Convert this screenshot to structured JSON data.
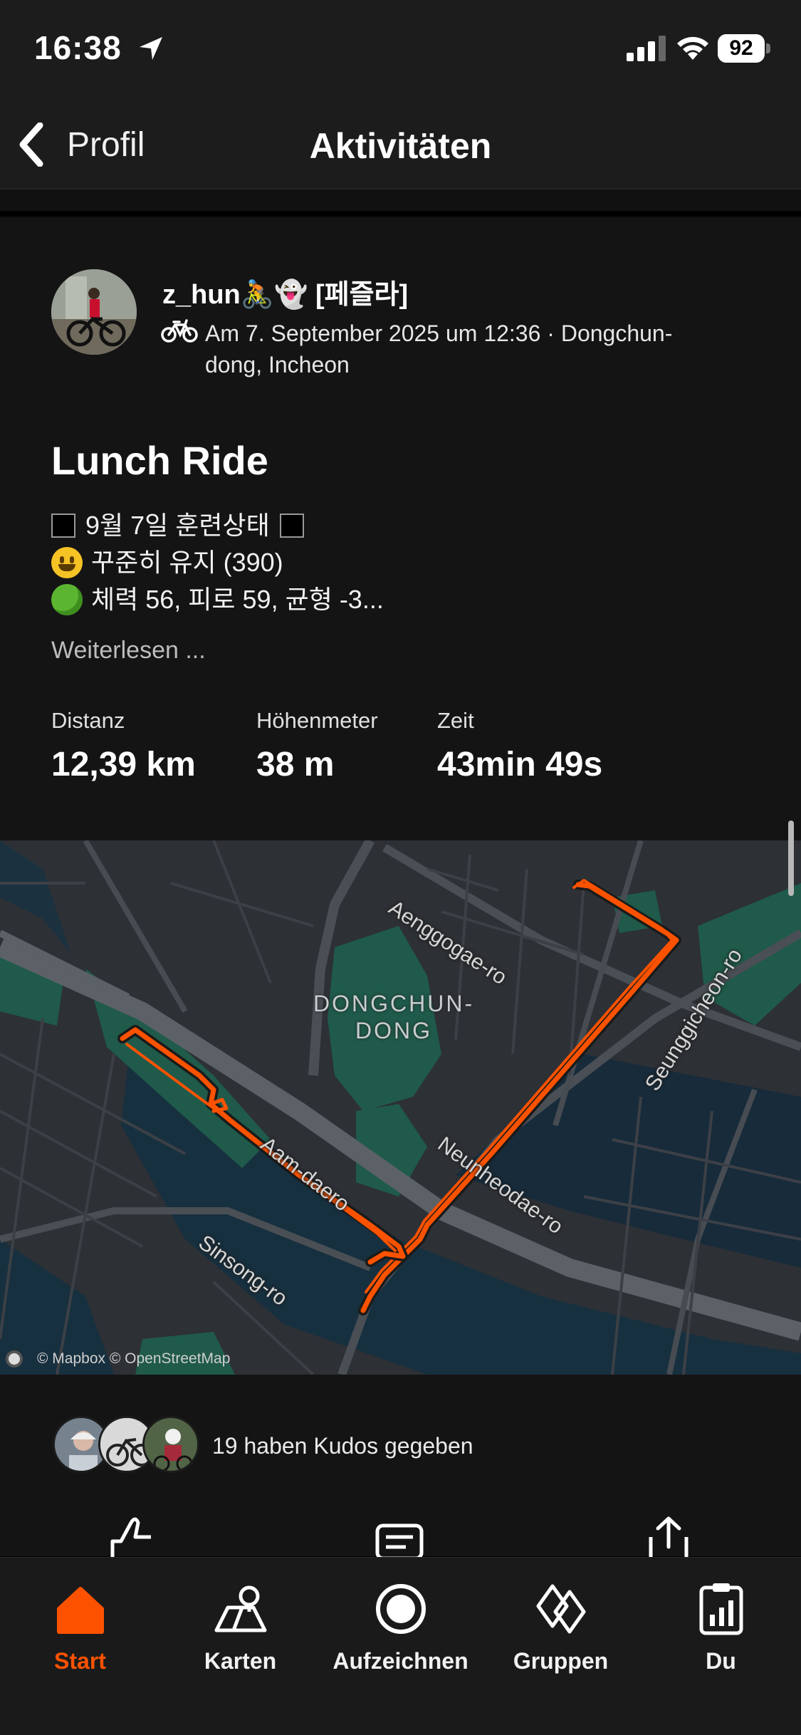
{
  "status_bar": {
    "time": "16:38",
    "battery": "92"
  },
  "header": {
    "back_label": "Profil",
    "title": "Aktivitäten"
  },
  "activity": {
    "athlete_name": "z_hun🚴👻 [페즐라]",
    "meta": "Am 7. September 2025 um 12:36 · Dongchun-dong, Incheon",
    "title": "Lunch Ride",
    "description": [
      {
        "text": "9월 7일 훈련상태",
        "icon": "black-square"
      },
      {
        "text": "꾸준히 유지 (390)",
        "icon": "smiley-emoji"
      },
      {
        "text": "체력 56, 피로 59, 균형 -3...",
        "icon": "tree-emoji"
      }
    ],
    "read_more": "Weiterlesen ...",
    "stats": [
      {
        "label": "Distanz",
        "value": "12,39 km"
      },
      {
        "label": "Höhenmeter",
        "value": "38 m"
      },
      {
        "label": "Zeit",
        "value": "43min 49s"
      }
    ]
  },
  "map": {
    "district": "DONGCHUN-\nDONG",
    "streets": [
      "Aenggogae-ro",
      "Seunggicheon-ro",
      "Aam-daero",
      "Neunheodae-ro",
      "Sinsong-ro"
    ],
    "attribution": "© Mapbox © OpenStreetMap",
    "route_color": "#fc5200"
  },
  "kudos": {
    "text": "19 haben Kudos gegeben"
  },
  "tabs": [
    {
      "label": "Start",
      "icon": "home-icon",
      "active": true
    },
    {
      "label": "Karten",
      "icon": "map-icon",
      "active": false
    },
    {
      "label": "Aufzeichnen",
      "icon": "record-icon",
      "active": false
    },
    {
      "label": "Gruppen",
      "icon": "groups-icon",
      "active": false
    },
    {
      "label": "Du",
      "icon": "profile-icon",
      "active": false
    }
  ],
  "colors": {
    "accent": "#fc5200",
    "background": "#141414"
  }
}
